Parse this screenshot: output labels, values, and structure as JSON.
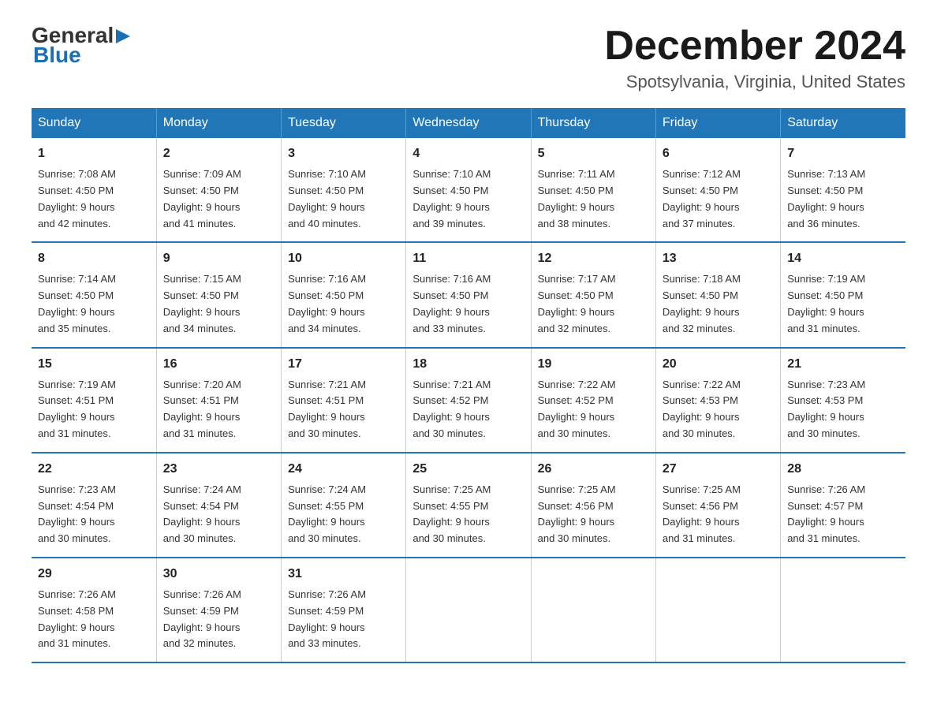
{
  "logo": {
    "line1": "General",
    "arrow": "▶",
    "line2": "Blue"
  },
  "header": {
    "month_title": "December 2024",
    "location": "Spotsylvania, Virginia, United States"
  },
  "days_of_week": [
    "Sunday",
    "Monday",
    "Tuesday",
    "Wednesday",
    "Thursday",
    "Friday",
    "Saturday"
  ],
  "weeks": [
    [
      {
        "day": "1",
        "sunrise": "7:08 AM",
        "sunset": "4:50 PM",
        "daylight": "9 hours and 42 minutes."
      },
      {
        "day": "2",
        "sunrise": "7:09 AM",
        "sunset": "4:50 PM",
        "daylight": "9 hours and 41 minutes."
      },
      {
        "day": "3",
        "sunrise": "7:10 AM",
        "sunset": "4:50 PM",
        "daylight": "9 hours and 40 minutes."
      },
      {
        "day": "4",
        "sunrise": "7:10 AM",
        "sunset": "4:50 PM",
        "daylight": "9 hours and 39 minutes."
      },
      {
        "day": "5",
        "sunrise": "7:11 AM",
        "sunset": "4:50 PM",
        "daylight": "9 hours and 38 minutes."
      },
      {
        "day": "6",
        "sunrise": "7:12 AM",
        "sunset": "4:50 PM",
        "daylight": "9 hours and 37 minutes."
      },
      {
        "day": "7",
        "sunrise": "7:13 AM",
        "sunset": "4:50 PM",
        "daylight": "9 hours and 36 minutes."
      }
    ],
    [
      {
        "day": "8",
        "sunrise": "7:14 AM",
        "sunset": "4:50 PM",
        "daylight": "9 hours and 35 minutes."
      },
      {
        "day": "9",
        "sunrise": "7:15 AM",
        "sunset": "4:50 PM",
        "daylight": "9 hours and 34 minutes."
      },
      {
        "day": "10",
        "sunrise": "7:16 AM",
        "sunset": "4:50 PM",
        "daylight": "9 hours and 34 minutes."
      },
      {
        "day": "11",
        "sunrise": "7:16 AM",
        "sunset": "4:50 PM",
        "daylight": "9 hours and 33 minutes."
      },
      {
        "day": "12",
        "sunrise": "7:17 AM",
        "sunset": "4:50 PM",
        "daylight": "9 hours and 32 minutes."
      },
      {
        "day": "13",
        "sunrise": "7:18 AM",
        "sunset": "4:50 PM",
        "daylight": "9 hours and 32 minutes."
      },
      {
        "day": "14",
        "sunrise": "7:19 AM",
        "sunset": "4:50 PM",
        "daylight": "9 hours and 31 minutes."
      }
    ],
    [
      {
        "day": "15",
        "sunrise": "7:19 AM",
        "sunset": "4:51 PM",
        "daylight": "9 hours and 31 minutes."
      },
      {
        "day": "16",
        "sunrise": "7:20 AM",
        "sunset": "4:51 PM",
        "daylight": "9 hours and 31 minutes."
      },
      {
        "day": "17",
        "sunrise": "7:21 AM",
        "sunset": "4:51 PM",
        "daylight": "9 hours and 30 minutes."
      },
      {
        "day": "18",
        "sunrise": "7:21 AM",
        "sunset": "4:52 PM",
        "daylight": "9 hours and 30 minutes."
      },
      {
        "day": "19",
        "sunrise": "7:22 AM",
        "sunset": "4:52 PM",
        "daylight": "9 hours and 30 minutes."
      },
      {
        "day": "20",
        "sunrise": "7:22 AM",
        "sunset": "4:53 PM",
        "daylight": "9 hours and 30 minutes."
      },
      {
        "day": "21",
        "sunrise": "7:23 AM",
        "sunset": "4:53 PM",
        "daylight": "9 hours and 30 minutes."
      }
    ],
    [
      {
        "day": "22",
        "sunrise": "7:23 AM",
        "sunset": "4:54 PM",
        "daylight": "9 hours and 30 minutes."
      },
      {
        "day": "23",
        "sunrise": "7:24 AM",
        "sunset": "4:54 PM",
        "daylight": "9 hours and 30 minutes."
      },
      {
        "day": "24",
        "sunrise": "7:24 AM",
        "sunset": "4:55 PM",
        "daylight": "9 hours and 30 minutes."
      },
      {
        "day": "25",
        "sunrise": "7:25 AM",
        "sunset": "4:55 PM",
        "daylight": "9 hours and 30 minutes."
      },
      {
        "day": "26",
        "sunrise": "7:25 AM",
        "sunset": "4:56 PM",
        "daylight": "9 hours and 30 minutes."
      },
      {
        "day": "27",
        "sunrise": "7:25 AM",
        "sunset": "4:56 PM",
        "daylight": "9 hours and 31 minutes."
      },
      {
        "day": "28",
        "sunrise": "7:26 AM",
        "sunset": "4:57 PM",
        "daylight": "9 hours and 31 minutes."
      }
    ],
    [
      {
        "day": "29",
        "sunrise": "7:26 AM",
        "sunset": "4:58 PM",
        "daylight": "9 hours and 31 minutes."
      },
      {
        "day": "30",
        "sunrise": "7:26 AM",
        "sunset": "4:59 PM",
        "daylight": "9 hours and 32 minutes."
      },
      {
        "day": "31",
        "sunrise": "7:26 AM",
        "sunset": "4:59 PM",
        "daylight": "9 hours and 33 minutes."
      },
      null,
      null,
      null,
      null
    ]
  ],
  "labels": {
    "sunrise": "Sunrise:",
    "sunset": "Sunset:",
    "daylight": "Daylight:"
  }
}
